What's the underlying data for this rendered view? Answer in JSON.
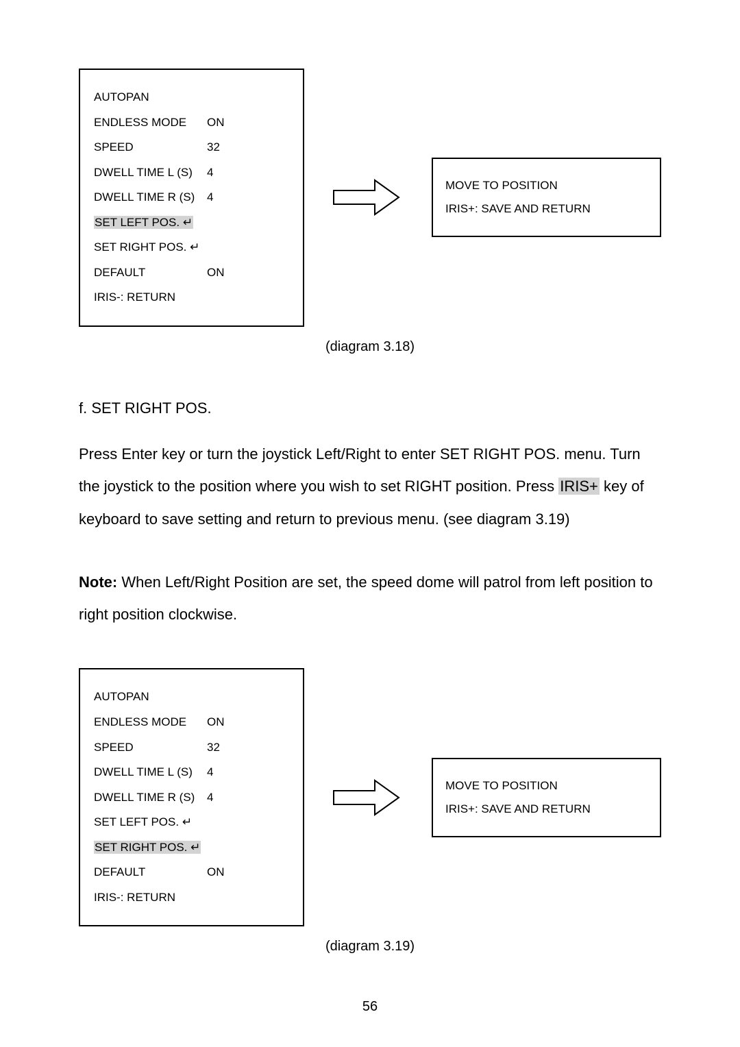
{
  "diagram1": {
    "menu": {
      "title": "AUTOPAN",
      "rows": [
        {
          "label": "ENDLESS MODE",
          "value": "ON"
        },
        {
          "label": "SPEED",
          "value": "32"
        },
        {
          "label": "DWELL TIME L (S)",
          "value": "4"
        },
        {
          "label": "DWELL TIME R (S)",
          "value": "4"
        }
      ],
      "set_left": "SET LEFT POS.",
      "set_right": "SET RIGHT POS.",
      "default_row": {
        "label": "DEFAULT",
        "value": "ON"
      },
      "return": "IRIS-: RETURN"
    },
    "info": {
      "line1": "MOVE TO POSITION",
      "line2": "IRIS+: SAVE AND RETURN"
    },
    "caption": "(diagram 3.18)"
  },
  "section": {
    "heading": "f. SET RIGHT POS.",
    "body_p1": "Press Enter key or turn the joystick Left/Right to enter SET RIGHT POS. menu. Turn the joystick to the position where you wish to set RIGHT position. Press ",
    "body_hl": "IRIS+",
    "body_p2": " key of keyboard to save setting and return to previous menu. (see diagram 3.19)",
    "note_label": "Note:",
    "note_text": " When Left/Right Position are set, the speed dome will patrol from left position to right position clockwise."
  },
  "diagram2": {
    "menu": {
      "title": "AUTOPAN",
      "rows": [
        {
          "label": "ENDLESS MODE",
          "value": "ON"
        },
        {
          "label": "SPEED",
          "value": "32"
        },
        {
          "label": "DWELL TIME L (S)",
          "value": "4"
        },
        {
          "label": "DWELL TIME R (S)",
          "value": "4"
        }
      ],
      "set_left": "SET LEFT POS.",
      "set_right": "SET RIGHT POS.",
      "default_row": {
        "label": "DEFAULT",
        "value": "ON"
      },
      "return": "IRIS-: RETURN"
    },
    "info": {
      "line1": "MOVE TO POSITION",
      "line2": "IRIS+: SAVE AND RETURN"
    },
    "caption": "(diagram 3.19)"
  },
  "page_number": "56",
  "enter_glyph": "↵"
}
